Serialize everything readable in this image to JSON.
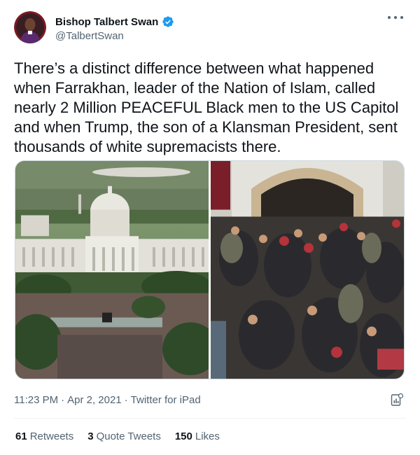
{
  "colors": {
    "verified_blue": "#1d9bf0",
    "secondary_text": "#536471",
    "primary_text": "#0f1419"
  },
  "author": {
    "display_name": "Bishop Talbert Swan",
    "handle": "@TalbertSwan",
    "verified": true,
    "verified_icon": "verified-badge-icon",
    "avatar_icon": "avatar"
  },
  "menu": {
    "icon": "more-options-icon"
  },
  "tweet": {
    "text": "There’s a distinct difference between what happened when Farrakhan, leader of the Nation of Islam, called nearly 2 Million PEACEFUL Black men to the US Capitol and when Trump, the son of a Klansman President, sent thousands of white supremacists there."
  },
  "media": {
    "images": [
      {
        "name": "capitol-crowd-photo"
      },
      {
        "name": "capitol-riot-photo"
      }
    ]
  },
  "meta": {
    "time": "11:23 PM",
    "separator": "·",
    "date": "Apr 2, 2021",
    "source": "Twitter for iPad",
    "analytics_icon": "analytics-icon"
  },
  "stats": {
    "retweets_count": "61",
    "retweets_label": "Retweets",
    "quote_count": "3",
    "quote_label": "Quote Tweets",
    "likes_count": "150",
    "likes_label": "Likes"
  }
}
